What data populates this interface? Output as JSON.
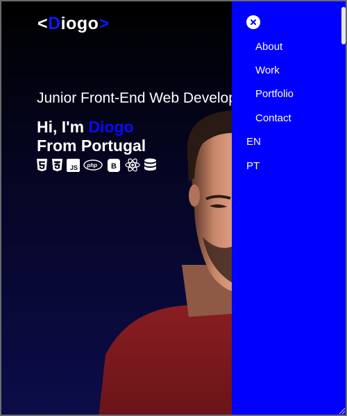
{
  "header": {
    "logo_open": "<",
    "logo_first": "D",
    "logo_rest": "iogo",
    "logo_close": ">"
  },
  "hero": {
    "subtitle": "Junior Front-End Web Developer",
    "greeting_prefix": "Hi, I'm ",
    "name": "Diogo",
    "origin": "From Portugal",
    "technologies": [
      "html5-icon",
      "css3-icon",
      "javascript-icon",
      "php-icon",
      "bootstrap-icon",
      "react-icon",
      "database-icon"
    ]
  },
  "drawer": {
    "close_icon": "close-icon",
    "menu": [
      {
        "label": "About"
      },
      {
        "label": "Work"
      },
      {
        "label": "Portfolio"
      },
      {
        "label": "Contact"
      }
    ],
    "languages": [
      {
        "label": "EN"
      },
      {
        "label": "PT"
      }
    ]
  },
  "colors": {
    "accent": "#0000ff",
    "name_highlight": "#0a0aff",
    "background_top": "#000000",
    "background_bottom": "#0c0c4a"
  }
}
